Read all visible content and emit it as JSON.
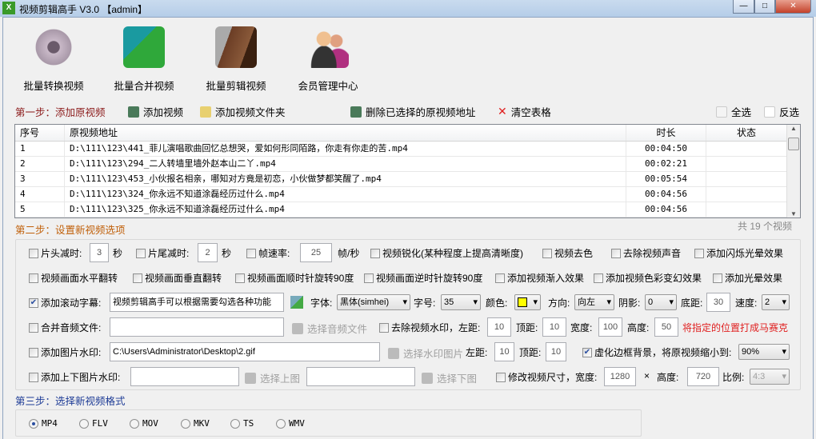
{
  "window": {
    "title": "视频剪辑高手 V3.0 【admin】",
    "icon": "X"
  },
  "toolbar": [
    {
      "label": "批量转换视频",
      "icon": "film-reel-icon"
    },
    {
      "label": "批量合并视频",
      "icon": "merge-film-icon"
    },
    {
      "label": "批量剪辑视频",
      "icon": "film-scissors-icon"
    },
    {
      "label": "会员管理中心",
      "icon": "users-icon"
    }
  ],
  "step1": {
    "label": "第一步：添加原视频",
    "add_video": "添加视频",
    "add_folder": "添加视频文件夹",
    "delete_selected": "删除已选择的原视频地址",
    "clear_table": "清空表格",
    "select_all": "全选",
    "invert": "反选"
  },
  "table": {
    "headers": [
      "序号",
      "原视频地址",
      "时长",
      "状态"
    ],
    "rows": [
      {
        "no": "1",
        "path": "D:\\111\\123\\441_菲儿演唱歌曲回忆总想哭，爱如何形同陌路，你走有你走的苦.mp4",
        "duration": "00:04:50",
        "status": ""
      },
      {
        "no": "2",
        "path": "D:\\111\\123\\294_二人转墙里墙外赵本山二丫.mp4",
        "duration": "00:02:21",
        "status": ""
      },
      {
        "no": "3",
        "path": "D:\\111\\123\\453_小伙报名相亲，哪知对方竟是初恋，小伙做梦都笑醒了.mp4",
        "duration": "00:05:54",
        "status": ""
      },
      {
        "no": "4",
        "path": "D:\\111\\123\\324_你永远不知道涂磊经历过什么.mp4",
        "duration": "00:04:56",
        "status": ""
      },
      {
        "no": "5",
        "path": "D:\\111\\123\\325_你永远不知道涂磊经历过什么.mp4",
        "duration": "00:04:56",
        "status": ""
      }
    ],
    "count": "共 19 个视频"
  },
  "step2": {
    "label": "第二步：设置新视频选项",
    "trim_head": "片头减时:",
    "trim_head_value": "3",
    "seconds": "秒",
    "trim_tail": "片尾减时:",
    "trim_tail_value": "2",
    "fps": "帧速率:",
    "fps_value": "25",
    "fps_unit": "帧/秒",
    "sharpen": "视频锐化(某种程度上提高清晰度)",
    "grayscale": "视频去色",
    "remove_audio": "去除视频声音",
    "flash_glow": "添加闪烁光晕效果",
    "flip_h": "视频画面水平翻转",
    "flip_v": "视频画面垂直翻转",
    "rotate_cw": "视频画面顺时针旋转90度",
    "rotate_ccw": "视频画面逆时针旋转90度",
    "fade_in": "添加视频渐入效果",
    "color_shift": "添加视频色彩变幻效果",
    "glow": "添加光晕效果",
    "scroll_text": "添加滚动字幕:",
    "scroll_text_value": "视频剪辑高手可以根据需要勾选各种功能",
    "font": "字体:",
    "font_value": "黑体(simhei)",
    "size": "字号:",
    "size_value": "35",
    "color": "颜色:",
    "color_value": "#ffff00",
    "direction": "方向:",
    "direction_value": "向左",
    "shadow": "阴影:",
    "shadow_value": "0",
    "bottom": "底距:",
    "bottom_value": "30",
    "speed": "速度:",
    "speed_value": "2",
    "merge_audio": "合并音频文件:",
    "merge_audio_value": "",
    "choose_audio": "选择音频文件",
    "remove_watermark": "去除视频水印，左距:",
    "wm_left": "10",
    "top": "顶距:",
    "wm_top": "10",
    "width": "宽度:",
    "wm_width": "100",
    "height": "高度:",
    "wm_height": "50",
    "mosaic_note": "将指定的位置打成马赛克",
    "image_watermark": "添加图片水印:",
    "image_watermark_value": "C:\\Users\\Administrator\\Desktop\\2.gif",
    "choose_watermark": "选择水印图片",
    "left": "左距:",
    "iw_left": "10",
    "iw_top": "10",
    "blur_border": "虚化边框背景，将原视频缩小到:",
    "shrink_value": "90%",
    "tb_watermark": "添加上下图片水印:",
    "choose_top": "选择上图",
    "choose_bottom": "选择下图",
    "resize": "修改视频尺寸，宽度:",
    "resize_width": "1280",
    "times": "×",
    "resize_height_label": "高度:",
    "resize_height": "720",
    "ratio": "比例:",
    "ratio_value": "4:3"
  },
  "step3": {
    "label": "第三步：选择新视频格式",
    "formats": [
      "MP4",
      "FLV",
      "MOV",
      "MKV",
      "TS",
      "WMV"
    ],
    "selected": "MP4"
  },
  "colors": {
    "step1": "#8b1a1a",
    "step2": "#c0600a",
    "step3": "#1e3c96",
    "mosaic": "#e02020"
  }
}
